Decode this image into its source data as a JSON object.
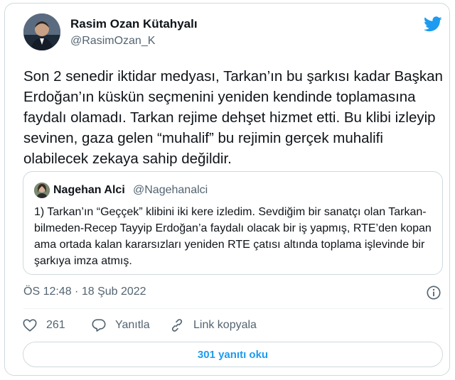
{
  "author": {
    "name": "Rasim Ozan Kütahyalı",
    "handle": "@RasimOzan_K"
  },
  "tweet": {
    "text": "Son 2 senedir iktidar medyası, Tarkan’ın bu şarkısı kadar Başkan Erdoğan’ın küskün seçmenini yeniden kendinde toplamasına faydalı olamadı. Tarkan rejime dehşet hizmet etti. Bu klibi izleyip sevinen, gaza gelen “muhalif” bu rejimin gerçek muhalifi olabilecek zekaya sahip değildir."
  },
  "quoted": {
    "name": "Nagehan Alci",
    "handle": "@Nagehanalci",
    "text": "1) Tarkan’ın “Geççek” klibini iki kere izledim. Sevdiğim bir sanatçı olan Tarkan-bilmeden-Recep Tayyip Erdoğan’a faydalı olacak bir iş yapmış, RTE’den kopan ama ortada kalan kararsızları yeniden RTE çatısı altında toplama işlevinde bir şarkıya imza atmış."
  },
  "timestamp": "ÖS 12:48 · 18 Şub 2022",
  "actions": {
    "likes": "261",
    "reply_label": "Yanıtla",
    "copy_link_label": "Link kopyala"
  },
  "read_replies_label": "301 yanıtı oku",
  "colors": {
    "accent": "#1d9bf0",
    "text": "#0f1419",
    "secondary": "#536471",
    "border": "#cfd9de"
  },
  "icons": [
    "twitter-bird-icon",
    "info-icon",
    "heart-icon",
    "reply-icon",
    "link-icon"
  ]
}
